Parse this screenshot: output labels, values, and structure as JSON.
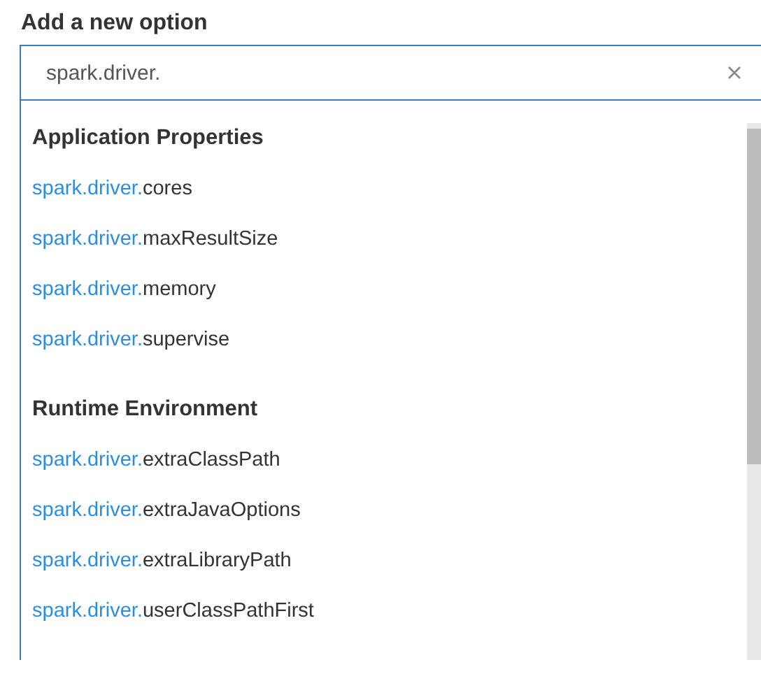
{
  "label": "Add a new option",
  "search": {
    "value": "spark.driver."
  },
  "groups": [
    {
      "heading": "Application Properties",
      "options": [
        {
          "match": "spark.driver.",
          "rest": "cores"
        },
        {
          "match": "spark.driver.",
          "rest": "maxResultSize"
        },
        {
          "match": "spark.driver.",
          "rest": "memory"
        },
        {
          "match": "spark.driver.",
          "rest": "supervise"
        }
      ]
    },
    {
      "heading": "Runtime Environment",
      "options": [
        {
          "match": "spark.driver.",
          "rest": "extraClassPath"
        },
        {
          "match": "spark.driver.",
          "rest": "extraJavaOptions"
        },
        {
          "match": "spark.driver.",
          "rest": "extraLibraryPath"
        },
        {
          "match": "spark.driver.",
          "rest": "userClassPathFirst"
        }
      ]
    }
  ]
}
